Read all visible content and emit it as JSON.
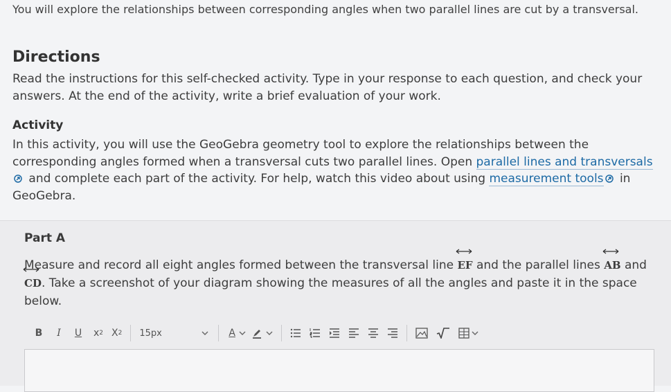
{
  "intro": "You will explore the relationships between corresponding angles when two parallel lines are cut by a transversal.",
  "directions": {
    "heading": "Directions",
    "text": "Read the instructions for this self-checked activity. Type in your response to each question, and check your answers. At the end of the activity, write a brief evaluation of your work."
  },
  "activity": {
    "heading": "Activity",
    "text_before_link1": "In this activity, you will use the GeoGebra geometry tool to explore the relationships between the corresponding angles formed when a transversal cuts two parallel lines. Open ",
    "link1": "parallel lines and transversals",
    "text_between": " and complete each part of the activity. For help, watch this video about using ",
    "link2": "measurement tools",
    "text_after": " in GeoGebra."
  },
  "part_a": {
    "heading": "Part A",
    "text1": "Measure and record all eight angles formed between the transversal line ",
    "line1": "EF",
    "text2": " and the parallel lines ",
    "line2": "AB",
    "text3": " and ",
    "line3": "CD",
    "text4": ". Take a screenshot of your diagram showing the measures of all the angles and paste it in the space below."
  },
  "toolbar": {
    "bold": "B",
    "italic": "I",
    "underline": "U",
    "superscript_base": "x",
    "superscript_exp": "2",
    "subscript_base": "X",
    "subscript_sub": "2",
    "font_size": "15px",
    "font_color": "A",
    "icons": [
      "chevron-down-icon",
      "highlighter-icon",
      "bulleted-list-icon",
      "numbered-list-icon",
      "indent-icon",
      "align-left-icon",
      "align-center-icon",
      "align-right-icon",
      "image-icon",
      "math-icon",
      "table-icon"
    ]
  }
}
